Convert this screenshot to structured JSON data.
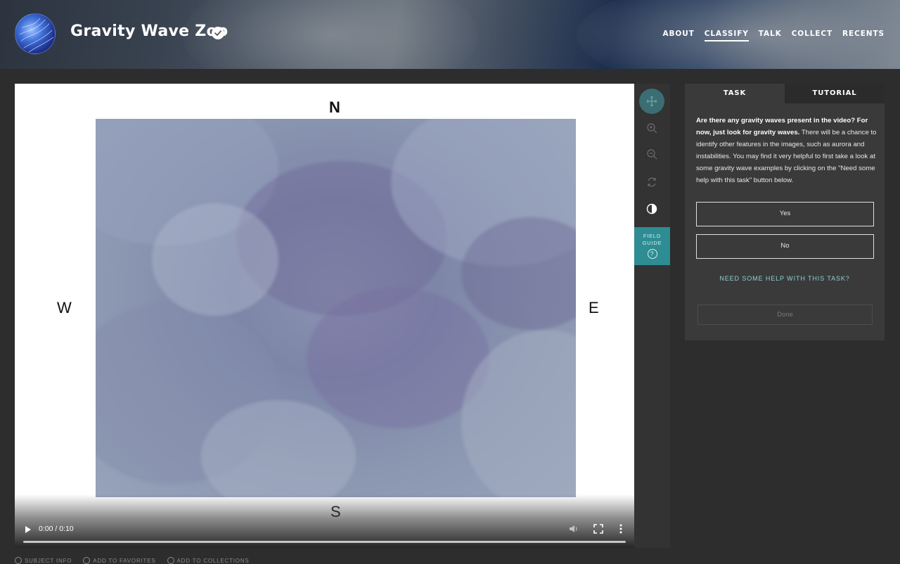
{
  "header": {
    "project_title": "Gravity Wave Zoo",
    "nav": [
      {
        "label": "ABOUT",
        "active": false
      },
      {
        "label": "CLASSIFY",
        "active": true
      },
      {
        "label": "TALK",
        "active": false
      },
      {
        "label": "COLLECT",
        "active": false
      },
      {
        "label": "RECENTS",
        "active": false
      }
    ]
  },
  "viewer": {
    "compass": {
      "north": "N",
      "south": "S",
      "west": "W",
      "east": "E"
    },
    "video": {
      "time": "0:00 / 0:10",
      "progress": 0.0
    }
  },
  "toolbar": {
    "tools": [
      "move-icon",
      "zoom-in-icon",
      "zoom-out-icon",
      "rotate-icon",
      "invert-icon"
    ],
    "field_guide_label_1": "FIELD",
    "field_guide_label_2": "GUIDE",
    "field_guide_icon": "?"
  },
  "task_panel": {
    "tabs": [
      {
        "label": "TASK",
        "active": true
      },
      {
        "label": "TUTORIAL",
        "active": false
      }
    ],
    "question_bold": "Are there any gravity waves present in the video? For now, just look for gravity waves.",
    "question_rest": " There will be a chance to identify other features in the images, such as aurora and instabilities. You may find it very helpful to first take a look at some gravity wave examples by clicking on the \"Need some help with this task\" button below.",
    "answers": [
      "Yes",
      "No"
    ],
    "help_link": "NEED SOME HELP WITH THIS TASK?",
    "done_label": "Done"
  },
  "meta": {
    "subject_info": "SUBJECT INFO",
    "add_favorites": "ADD TO FAVORITES",
    "add_collections": "ADD TO COLLECTIONS"
  },
  "colors": {
    "page_bg": "#2d2d2d",
    "accent_teal": "#2d8d93",
    "link_teal": "#8fd0d6",
    "panel_bg": "#3a3a3a"
  }
}
